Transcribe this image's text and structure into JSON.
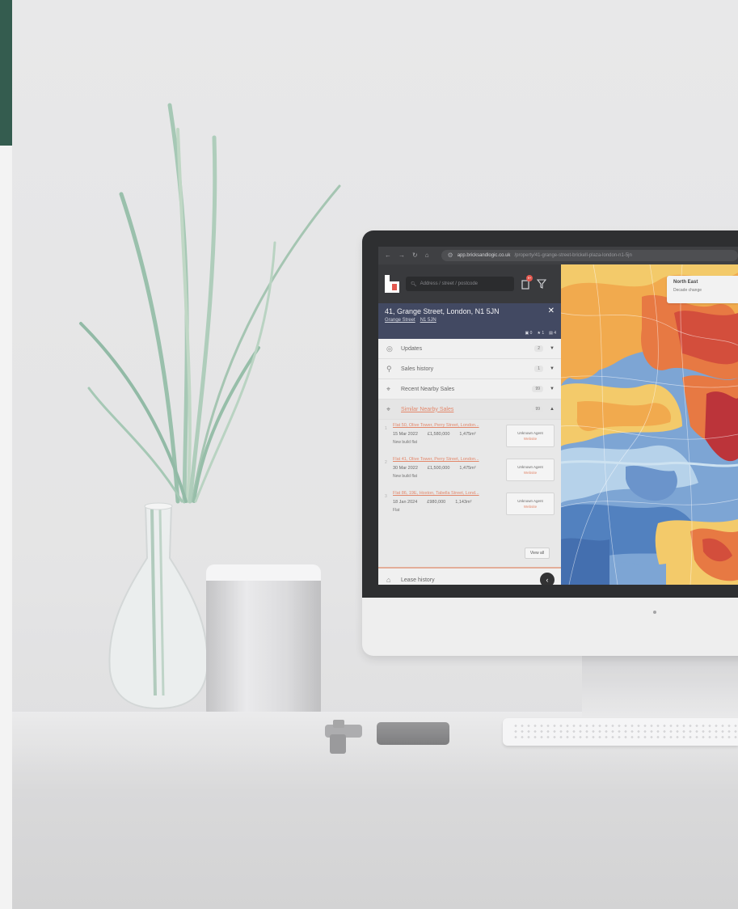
{
  "browser": {
    "url_domain": "app.bricksandlogic.co.uk",
    "url_path": "/property/41-grange-street-brickell-plaza-london-n1-5jn"
  },
  "sidebar": {
    "search_placeholder": "Address / street / postcode",
    "notification_count": "9+",
    "property": {
      "title": "41, Grange Street, London, N1 5JN",
      "street_link": "Grange Street",
      "postcode_link": "N1 5JN",
      "stats": [
        "0",
        "1",
        "4"
      ]
    },
    "sections": [
      {
        "label": "Updates",
        "count": "2",
        "icon": "globe-icon"
      },
      {
        "label": "Sales history",
        "count": "1",
        "icon": "person-icon"
      },
      {
        "label": "Recent Nearby Sales",
        "count": "99",
        "icon": "pin-icon"
      },
      {
        "label": "Similar Nearby Sales",
        "count": "99",
        "icon": "pin-icon"
      }
    ],
    "sales": [
      {
        "title": "Flat 50, Olive Tower, Perry Street, London...",
        "date": "15 Mar 2022",
        "price": "£1,580,000",
        "area": "1,475m²",
        "type": "New build flat",
        "agent": "Unknown Agent",
        "agent_link": "Website"
      },
      {
        "title": "Flat 41, Olive Tower, Perry Street, London...",
        "date": "30 Mar 2022",
        "price": "£1,500,000",
        "area": "1,475m²",
        "type": "New build flat",
        "agent": "Unknown Agent",
        "agent_link": "Website"
      },
      {
        "title": "Flat 86, 19E, Hoxton, Tabella Street, Lond...",
        "date": "18 Jan 2024",
        "price": "£980,000",
        "area": "1,143m²",
        "type": "Flat",
        "agent": "Unknown Agent",
        "agent_link": "Website"
      }
    ],
    "view_all": "View all",
    "lease_label": "Lease history"
  },
  "map": {
    "region_title": "North East",
    "region_sub": "Decade change"
  },
  "colors": {
    "brand_dark": "#232428",
    "address_bg": "#2d3551",
    "accent": "#e07a5a",
    "green_bar": "#1d4a3c"
  }
}
